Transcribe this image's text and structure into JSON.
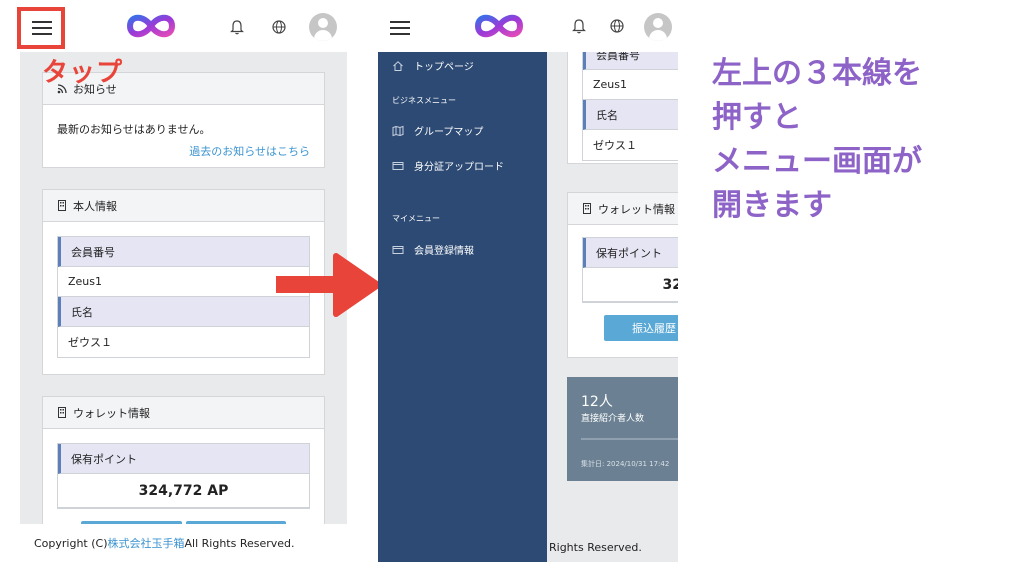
{
  "left_screen": {
    "tap_label": "タップ",
    "news": {
      "title": "お知らせ",
      "empty_text": "最新のお知らせはありません。",
      "past_link": "過去のお知らせはこちら"
    },
    "profile": {
      "title": "本人情報",
      "member_no_label": "会員番号",
      "member_no_value": "Zeus1",
      "name_label": "氏名",
      "name_value": "ゼウス１"
    },
    "wallet": {
      "title": "ウォレット情報",
      "points_label": "保有ポイント",
      "points_value": "324,772 AP"
    },
    "footer": {
      "prefix": "Copyright (C) ",
      "company": "株式会社玉手箱",
      "suffix": " All Rights Reserved."
    }
  },
  "right_screen": {
    "menu": {
      "top_page": "トップページ",
      "business_section": "ビジネスメニュー",
      "group_map": "グループマップ",
      "id_upload": "身分証アップロード",
      "my_section": "マイメニュー",
      "member_info": "会員登録情報"
    },
    "profile": {
      "member_no_label": "会員番号",
      "member_no_value": "Zeus1",
      "name_label": "氏名",
      "name_value": "ゼウス１"
    },
    "wallet": {
      "title": "ウォレット情報",
      "points_label": "保有ポイント",
      "points_value_partial": "32",
      "history_button": "振込履歴"
    },
    "stats": {
      "count": "12人",
      "label": "直接紹介者人数",
      "timestamp": "集計日: 2024/10/31 17:42"
    },
    "footer_partial": "Rights Reserved."
  },
  "instructions": [
    "左上の３本線を",
    "押すと",
    "メニュー画面が",
    "開きます"
  ],
  "colors": {
    "highlight_red": "#e8443a",
    "arrow_red": "#e8443a",
    "sidebar_navy": "#2c4a73",
    "instruction_purple": "#8d63c8",
    "link_blue": "#3a93d0",
    "button_blue": "#5aa8d6"
  },
  "icons": [
    "hamburger-icon",
    "infinity-logo",
    "bell-icon",
    "globe-icon",
    "avatar",
    "rss-icon",
    "building-icon",
    "home-icon",
    "map-icon",
    "card-icon",
    "arrow-right-icon"
  ]
}
